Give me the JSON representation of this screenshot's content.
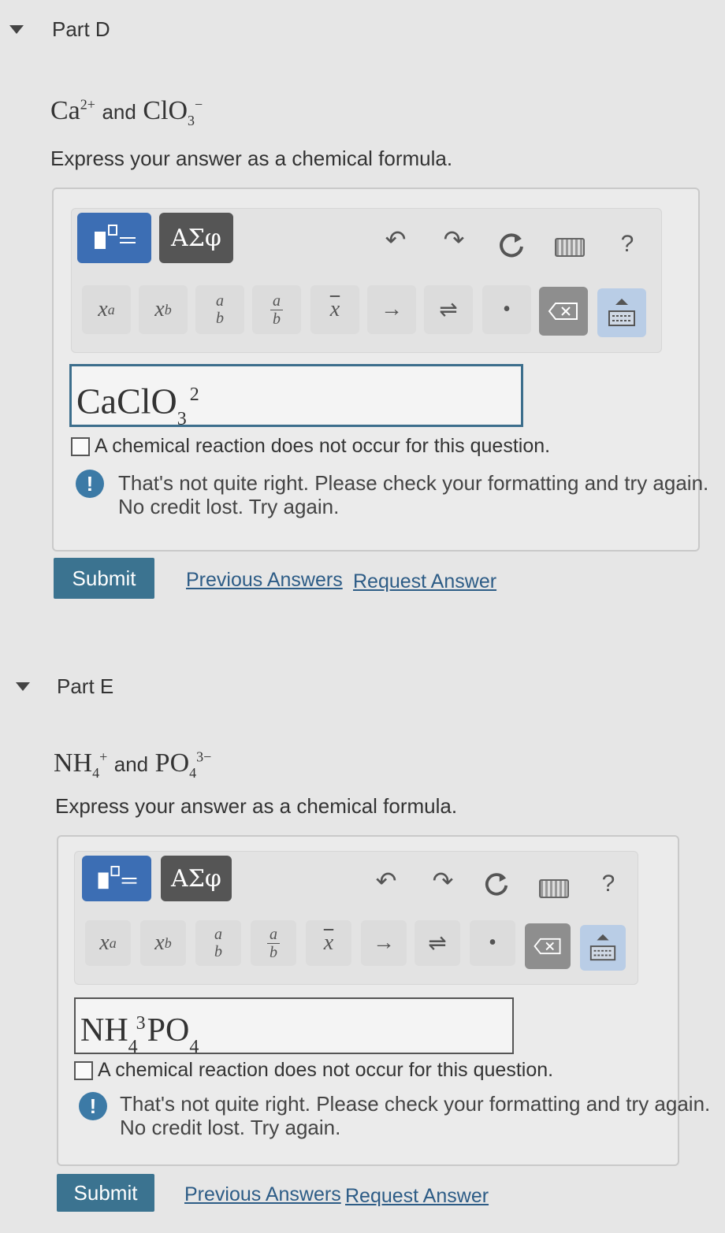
{
  "parts": [
    {
      "title": "Part D",
      "ion1": {
        "base": "Ca",
        "sup": "2+"
      },
      "conjunction": "and",
      "ion2": {
        "base": "ClO",
        "sub": "3",
        "sup": "−"
      },
      "instruction": "Express your answer as a chemical formula.",
      "toolbar": {
        "greek_label": "ΑΣφ",
        "help_label": "?"
      },
      "keys": {
        "sup_label": "x",
        "sup_exp": "a",
        "sub_label": "x",
        "sub_idx": "b",
        "frac_num": "a",
        "frac_den": "b",
        "bar_label": "x",
        "arrow": "→",
        "equilibrium": "⇌",
        "dot": "•"
      },
      "answer": {
        "main": "CaClO",
        "sub": "3",
        "sup": "2"
      },
      "no_reaction_label": "A chemical reaction does not occur for this question.",
      "feedback": {
        "line1": "That's not quite right. Please check your formatting and try again.",
        "line2": "No credit lost. Try again."
      },
      "submit_label": "Submit",
      "previous_answers_label": "Previous Answers",
      "request_answer_label": "Request Answer"
    },
    {
      "title": "Part E",
      "ion1": {
        "base": "NH",
        "sub": "4",
        "sup": "+"
      },
      "conjunction": "and",
      "ion2": {
        "base": "PO",
        "sub": "4",
        "sup": "3−"
      },
      "instruction": "Express your answer as a chemical formula.",
      "toolbar": {
        "greek_label": "ΑΣφ",
        "help_label": "?"
      },
      "keys": {
        "sup_label": "x",
        "sup_exp": "a",
        "sub_label": "x",
        "sub_idx": "b",
        "frac_num": "a",
        "frac_den": "b",
        "bar_label": "x",
        "arrow": "→",
        "equilibrium": "⇌",
        "dot": "•"
      },
      "answer": {
        "a": "NH",
        "a_sub": "4",
        "a_sup": "3",
        "b": "PO",
        "b_sub": "4"
      },
      "no_reaction_label": "A chemical reaction does not occur for this question.",
      "feedback": {
        "line1": "That's not quite right. Please check your formatting and try again.",
        "line2": "No credit lost. Try again."
      },
      "submit_label": "Submit",
      "previous_answers_label": "Previous Answers",
      "request_answer_label": "Request Answer"
    }
  ]
}
